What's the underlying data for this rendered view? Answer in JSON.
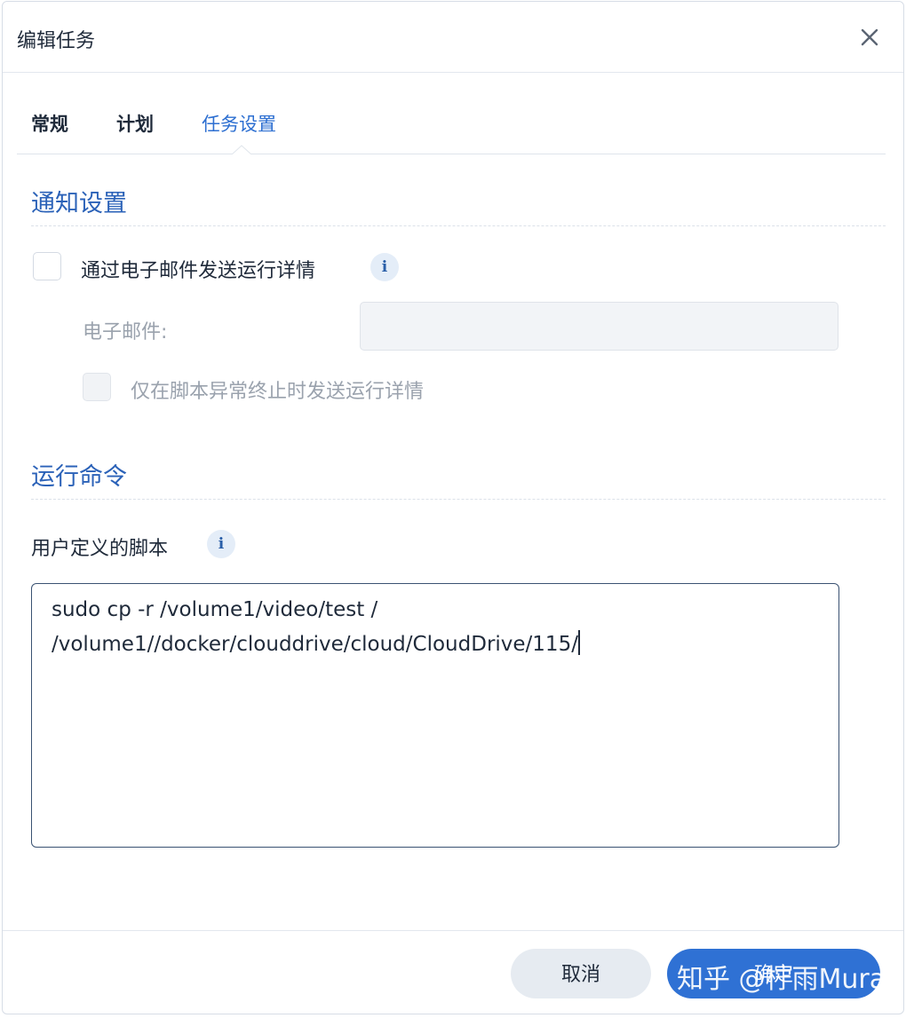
{
  "dialog": {
    "title": "编辑任务",
    "close_icon": "close-icon"
  },
  "tabs": [
    {
      "label": "常规",
      "active": false
    },
    {
      "label": "计划",
      "active": false
    },
    {
      "label": "任务设置",
      "active": true
    }
  ],
  "notification": {
    "section_title": "通知设置",
    "email_checkbox_label": "通过电子邮件发送运行详情",
    "email_checkbox_checked": false,
    "email_label": "电子邮件:",
    "email_value": "",
    "only_abnormal_label": "仅在脚本异常终止时发送运行详情",
    "only_abnormal_checked": false
  },
  "run_command": {
    "section_title": "运行命令",
    "script_label": "用户定义的脚本",
    "script_line1": "sudo cp -r /volume1/video/test /",
    "script_line2": "/volume1//docker/clouddrive/cloud/CloudDrive/115/"
  },
  "footer": {
    "cancel_label": "取消",
    "ok_label": "确定",
    "watermark": "知乎 @柠雨Mura"
  },
  "colors": {
    "accent": "#2d6fd1",
    "section_title": "#2b62b8",
    "primary_button": "#2f71d4",
    "secondary_button": "#e6ebf1"
  }
}
